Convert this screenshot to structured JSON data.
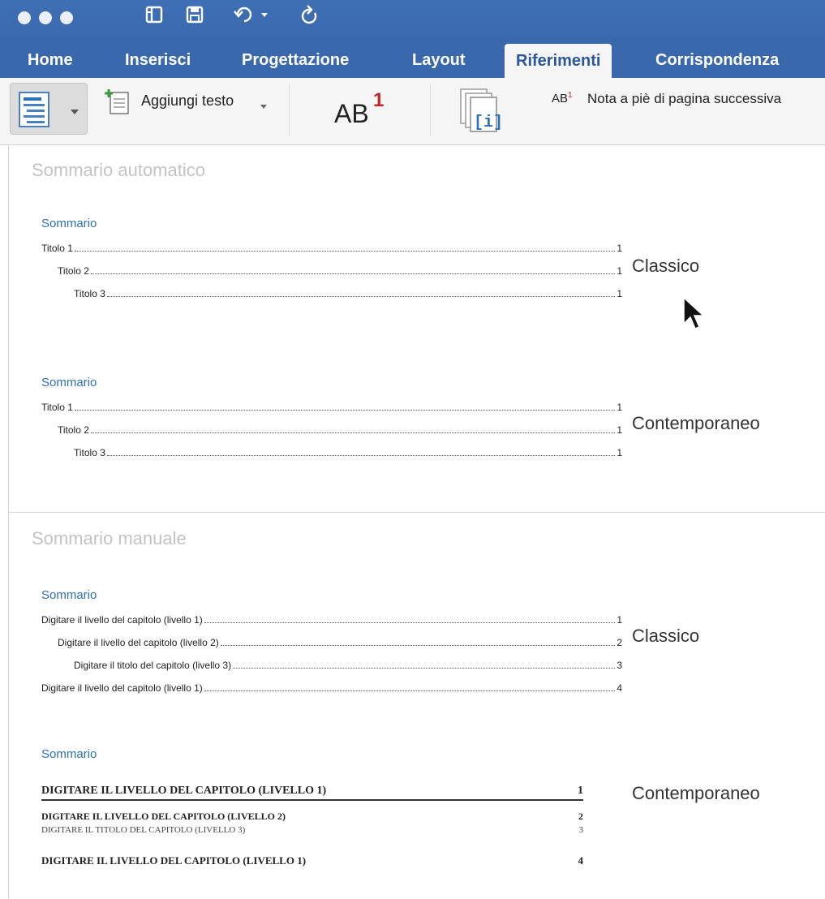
{
  "window": {
    "quick_access": [
      "layout-icon",
      "save-icon",
      "undo-icon",
      "redo-icon"
    ]
  },
  "tabs": [
    {
      "label": "Home"
    },
    {
      "label": "Inserisci"
    },
    {
      "label": "Progettazione"
    },
    {
      "label": "Layout"
    },
    {
      "label": "Riferimenti",
      "active": true
    },
    {
      "label": "Corrispondenza"
    }
  ],
  "ribbon": {
    "add_text_label": "Aggiungi testo",
    "footnote_icon_text": "AB",
    "footnote_superscript": "1",
    "next_footnote_label": "Nota a piè di pagina successiva",
    "next_footnote_icon_text": "AB",
    "next_footnote_icon_sup": "1"
  },
  "gallery": {
    "automatic_heading": "Sommario automatico",
    "manual_heading": "Sommario manuale",
    "auto_classic": {
      "title": "Sommario",
      "style_label": "Classico",
      "lines": [
        {
          "text": "Titolo 1",
          "page": "1"
        },
        {
          "text": "Titolo 2",
          "page": "1"
        },
        {
          "text": "Titolo 3",
          "page": "1"
        }
      ]
    },
    "auto_contemporary": {
      "title": "Sommario",
      "style_label": "Contemporaneo",
      "lines": [
        {
          "text": "Titolo 1",
          "page": "1"
        },
        {
          "text": "Titolo 2",
          "page": "1"
        },
        {
          "text": "Titolo 3",
          "page": "1"
        }
      ]
    },
    "manual_classic": {
      "title": "Sommario",
      "style_label": "Classico",
      "lines": [
        {
          "text": "Digitare il livello del capitolo (livello 1)",
          "page": "1"
        },
        {
          "text": "Digitare il livello del capitolo (livello 2)",
          "page": "2"
        },
        {
          "text": "Digitare il titolo del capitolo (livello 3)",
          "page": "3"
        },
        {
          "text": "Digitare il livello del capitolo (livello 1)",
          "page": "4"
        }
      ]
    },
    "manual_contemporary": {
      "title": "Sommario",
      "style_label": "Contemporaneo",
      "lines": [
        {
          "text": "DIGITARE IL LIVELLO DEL CAPITOLO (LIVELLO 1)",
          "page": "1"
        },
        {
          "text": "DIGITARE IL LIVELLO DEL CAPITOLO (LIVELLO 2)",
          "page": "2"
        },
        {
          "text": "DIGITARE IL TITOLO DEL CAPITOLO (LIVELLO 3)",
          "page": "3"
        },
        {
          "text": "DIGITARE IL LIVELLO DEL CAPITOLO (LIVELLO 1)",
          "page": "4"
        }
      ]
    }
  },
  "colors": {
    "titlebar": "#3a68ad",
    "toc_title": "#2f6fb5",
    "footnote_superscript": "#c0262c"
  }
}
